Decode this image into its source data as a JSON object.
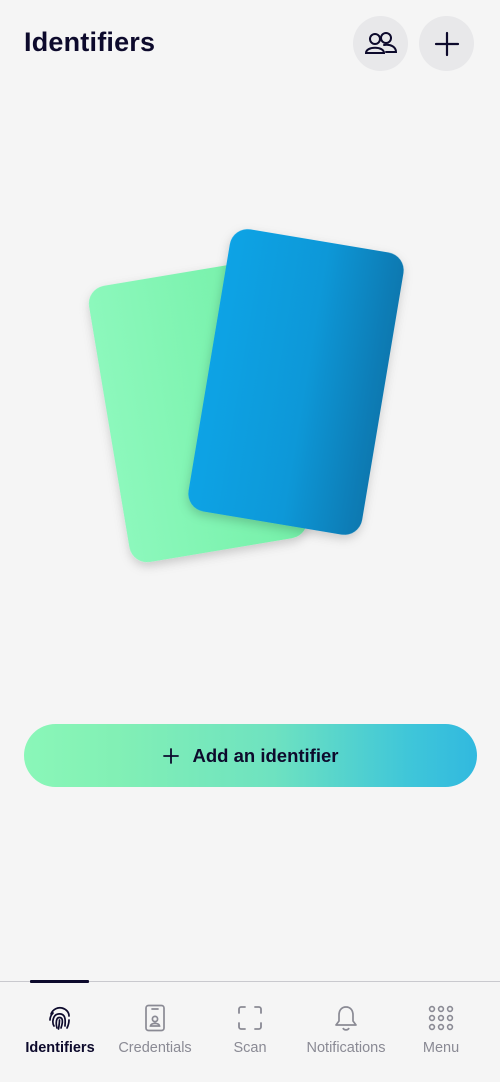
{
  "header": {
    "title": "Identifiers",
    "connections_icon": "people-icon",
    "add_icon": "plus-icon"
  },
  "illustration": {
    "back_card_colors": [
      "#8cf8bc",
      "#74f0a8"
    ],
    "front_card_colors": [
      "#0aa3e5",
      "#0778b0"
    ]
  },
  "cta": {
    "label": "Add an identifier",
    "icon": "plus-icon"
  },
  "tabbar": {
    "active_color": "#0d0a2c",
    "inactive_color": "#8a8a94",
    "tabs": [
      {
        "label": "Identifiers",
        "icon": "fingerprint-icon",
        "active": true
      },
      {
        "label": "Credentials",
        "icon": "id-card-icon",
        "active": false
      },
      {
        "label": "Scan",
        "icon": "scan-icon",
        "active": false
      },
      {
        "label": "Notifications",
        "icon": "bell-icon",
        "active": false
      },
      {
        "label": "Menu",
        "icon": "grid-icon",
        "active": false
      }
    ]
  }
}
